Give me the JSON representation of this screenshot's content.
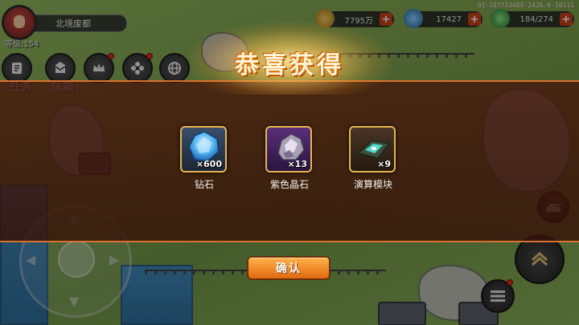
{
  "hud": {
    "location": "北境废都",
    "level": "等级:154",
    "build_id": "01-107733483-2426.0-10111",
    "menu": [
      {
        "label": "任务",
        "icon": "scroll-icon"
      },
      {
        "label": "信箱",
        "icon": "mail-icon"
      },
      {
        "label": "",
        "icon": "crown-icon",
        "badge": true
      },
      {
        "label": "",
        "icon": "flower-icon",
        "badge": true
      },
      {
        "label": "",
        "icon": "globe-icon",
        "badge": false
      }
    ],
    "resources": [
      {
        "value": "7795万",
        "icon": "gold-coin-icon",
        "color": "#d9a232"
      },
      {
        "value": "17427",
        "icon": "blue-gem-icon",
        "color": "#3a8fd6"
      },
      {
        "value": "184/274",
        "icon": "energy-leaf-icon",
        "color": "#3fb34a"
      }
    ]
  },
  "modal": {
    "title": "恭喜获得",
    "confirm_label": "确认",
    "rewards": [
      {
        "name": "钻石",
        "quantity": "×600",
        "icon": "diamond-icon"
      },
      {
        "name": "紫色晶石",
        "quantity": "×13",
        "icon": "purple-crystal-icon"
      },
      {
        "name": "演算模块",
        "quantity": "×9",
        "icon": "compute-module-icon"
      }
    ]
  },
  "colors": {
    "accent_orange": "#e06a10",
    "modal_border": "#d8722c",
    "title_glow": "#ff8a00"
  }
}
